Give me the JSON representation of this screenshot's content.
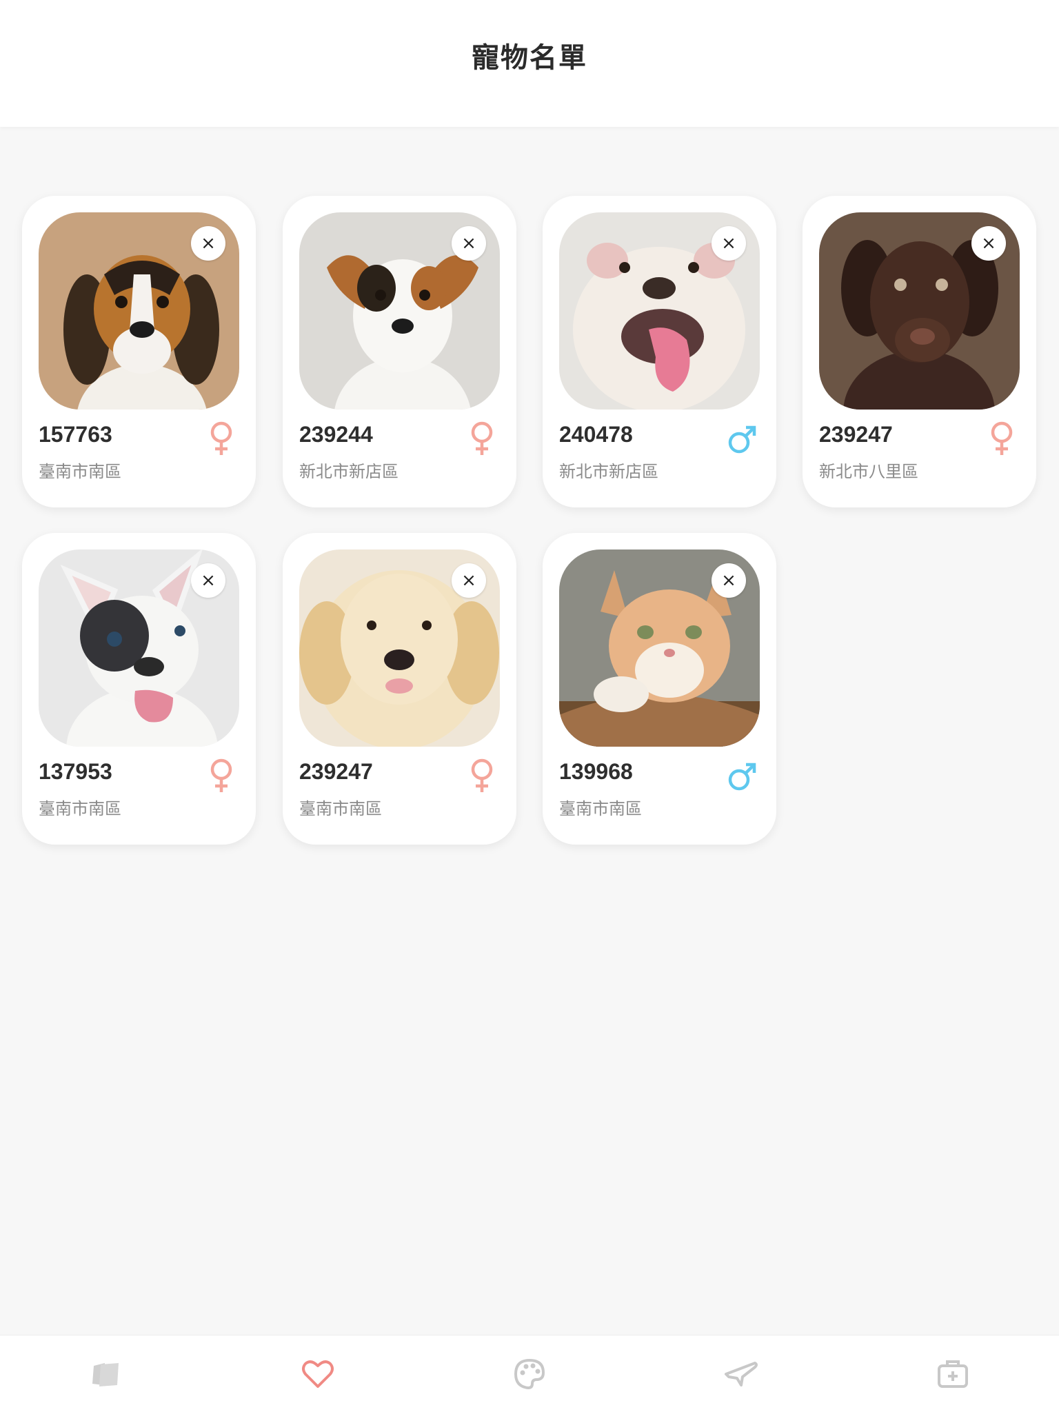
{
  "header": {
    "title": "寵物名單"
  },
  "colors": {
    "female": "#f4a59a",
    "male": "#5ec8ee",
    "tab_active": "#f08a84",
    "tab_inactive": "#c8c8c8"
  },
  "close_glyph": "×",
  "pets": [
    {
      "id": "157763",
      "location": "臺南市南區",
      "gender": "female",
      "photo": "beagle-puppy"
    },
    {
      "id": "239244",
      "location": "新北市新店區",
      "gender": "female",
      "photo": "jack-russell-puppy"
    },
    {
      "id": "240478",
      "location": "新北市新店區",
      "gender": "male",
      "photo": "bulldog"
    },
    {
      "id": "239247",
      "location": "新北市八里區",
      "gender": "female",
      "photo": "chocolate-labrador-puppy"
    },
    {
      "id": "137953",
      "location": "臺南市南區",
      "gender": "female",
      "photo": "french-bulldog"
    },
    {
      "id": "239247",
      "location": "臺南市南區",
      "gender": "female",
      "photo": "golden-retriever-puppy"
    },
    {
      "id": "139968",
      "location": "臺南市南區",
      "gender": "male",
      "photo": "orange-cat"
    }
  ],
  "tabbar": [
    {
      "icon": "cards-icon",
      "active": false
    },
    {
      "icon": "heart-icon",
      "active": true
    },
    {
      "icon": "palette-icon",
      "active": false
    },
    {
      "icon": "plane-icon",
      "active": false
    },
    {
      "icon": "medical-kit-icon",
      "active": false
    }
  ]
}
